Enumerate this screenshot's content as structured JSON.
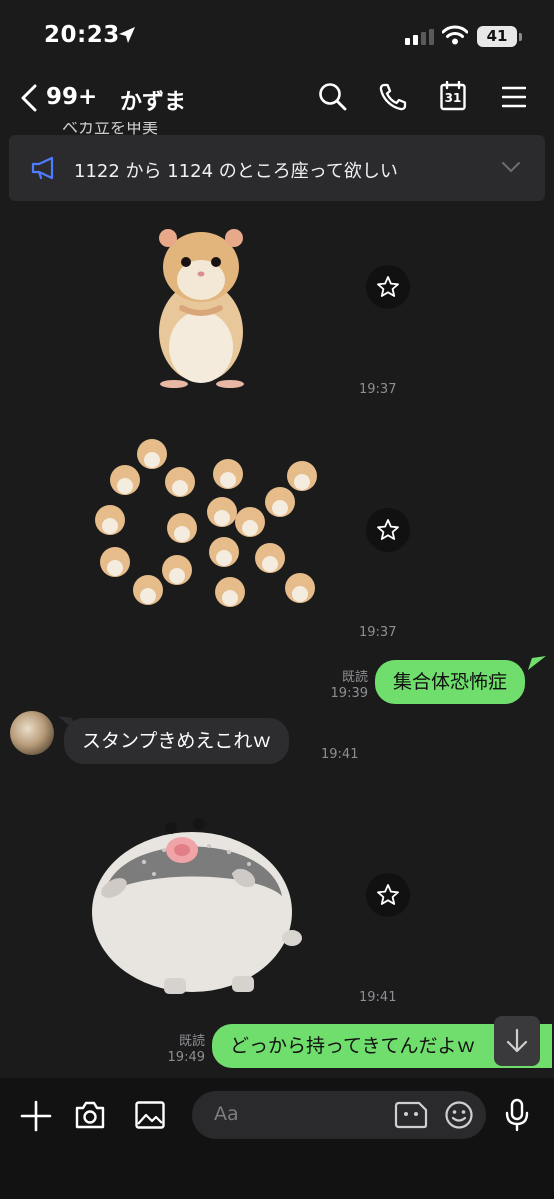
{
  "status": {
    "time": "20:23",
    "battery": "41"
  },
  "header": {
    "back_count": "99+",
    "title": "かずま",
    "calendar_day": "31"
  },
  "peek_text": "ベカ立を甲美",
  "announcement": {
    "text": "1122 から 1124 のところ座って欲しい"
  },
  "messages": {
    "sticker1_time": "19:37",
    "sticker2_time": "19:37",
    "sent1": {
      "read": "既読",
      "time": "19:39",
      "text": "集合体恐怖症"
    },
    "recv1": {
      "text": "スタンプきめえこれｗ",
      "time": "19:41"
    },
    "sticker3_time": "19:41",
    "sent2": {
      "read": "既読",
      "time": "19:49",
      "text": "どっから持ってきてんだよｗ"
    }
  },
  "composer": {
    "placeholder": "Aa"
  },
  "colors": {
    "green_bubble": "#70de6c",
    "background": "#1b1b1c",
    "accent_blue": "#4d7cff"
  }
}
